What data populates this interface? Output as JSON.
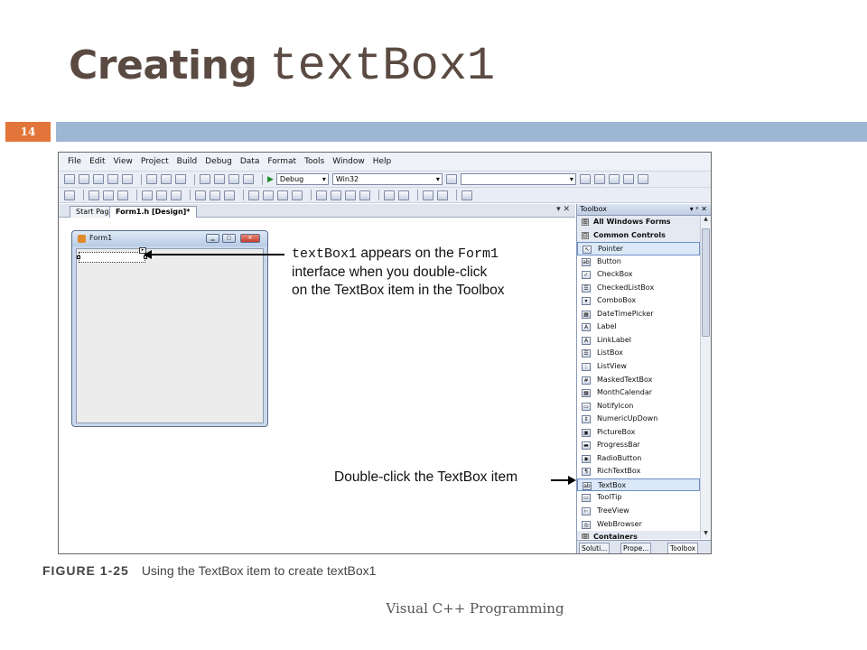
{
  "slide": {
    "title_word": "Creating",
    "title_code": "textBox1",
    "number": "14",
    "footer": "Visual C++ Programming",
    "caption_label": "FIGURE 1-25",
    "caption_text": "Using the TextBox item to create textBox1",
    "accent_color": "#e2763a",
    "bar_color": "#9cb6d4"
  },
  "ide": {
    "menus": [
      "File",
      "Edit",
      "View",
      "Project",
      "Build",
      "Debug",
      "Data",
      "Format",
      "Tools",
      "Window",
      "Help"
    ],
    "config_combo": "Debug",
    "platform_combo": "Win32",
    "doc_tabs": [
      "Start Page",
      "Form1.h [Design]*"
    ],
    "tab_controls": "▾ ✕",
    "form_title": "Form1",
    "toolbox": {
      "title": "Toolbox",
      "header_controls": "▾ ᵖ ✕",
      "items": [
        {
          "label": "All Windows Forms",
          "group": true,
          "sign": "⊞"
        },
        {
          "label": "Common Controls",
          "group": true,
          "sign": "⊟"
        },
        {
          "label": "Pointer",
          "icon": "↖",
          "selected": true
        },
        {
          "label": "Button",
          "icon": "ab"
        },
        {
          "label": "CheckBox",
          "icon": "✓"
        },
        {
          "label": "CheckedListBox",
          "icon": "☰"
        },
        {
          "label": "ComboBox",
          "icon": "▾"
        },
        {
          "label": "DateTimePicker",
          "icon": "▦"
        },
        {
          "label": "Label",
          "icon": "A"
        },
        {
          "label": "LinkLabel",
          "icon": "A"
        },
        {
          "label": "ListBox",
          "icon": "☰"
        },
        {
          "label": "ListView",
          "icon": "⋮"
        },
        {
          "label": "MaskedTextBox",
          "icon": "#"
        },
        {
          "label": "MonthCalendar",
          "icon": "▦"
        },
        {
          "label": "NotifyIcon",
          "icon": "▭"
        },
        {
          "label": "NumericUpDown",
          "icon": "⇕"
        },
        {
          "label": "PictureBox",
          "icon": "▣"
        },
        {
          "label": "ProgressBar",
          "icon": "▬"
        },
        {
          "label": "RadioButton",
          "icon": "◉"
        },
        {
          "label": "RichTextBox",
          "icon": "¶"
        },
        {
          "label": "TextBox",
          "icon": "ab",
          "selected": true
        },
        {
          "label": "ToolTip",
          "icon": "▭"
        },
        {
          "label": "TreeView",
          "icon": "⊢"
        },
        {
          "label": "WebBrowser",
          "icon": "◎"
        },
        {
          "label": "Containers",
          "group": true,
          "sign": "⊞"
        }
      ],
      "bottom_tabs": [
        "Soluti...",
        "Prope...",
        "Toolbox"
      ]
    }
  },
  "callouts": {
    "top_line1_code": "textBox1",
    "top_line1_text": " appears on the ",
    "top_line1_code2": "Form1",
    "top_line2": "interface when you double-click",
    "top_line3": "on the TextBox item in the Toolbox",
    "bottom": "Double-click the TextBox item"
  }
}
